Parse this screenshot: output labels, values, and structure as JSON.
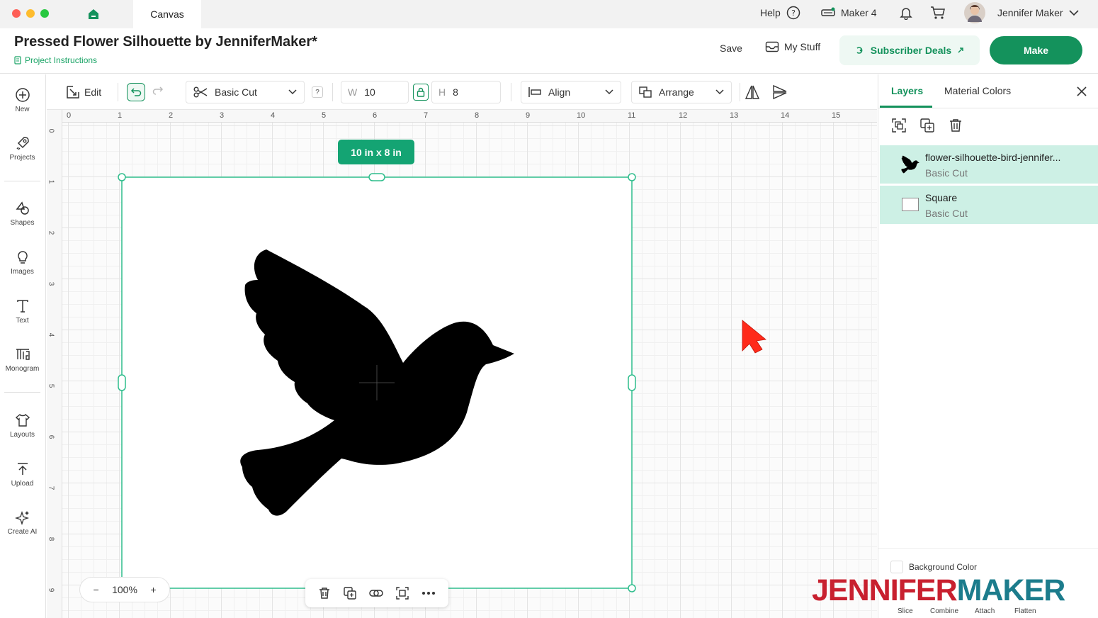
{
  "window": {
    "tab_title": "Canvas",
    "help_label": "Help",
    "machine_label": "Maker 4",
    "user_name": "Jennifer Maker"
  },
  "project": {
    "title": "Pressed Flower Silhouette by JenniferMaker*",
    "instructions_label": "Project Instructions",
    "save_label": "Save",
    "mystuff_label": "My Stuff",
    "deals_label": "Subscriber Deals",
    "make_label": "Make"
  },
  "sidebar": {
    "items": [
      {
        "label": "New",
        "icon": "plus-circle-icon"
      },
      {
        "label": "Projects",
        "icon": "rocket-icon"
      },
      {
        "label": "Shapes",
        "icon": "shapes-icon"
      },
      {
        "label": "Images",
        "icon": "lightbulb-icon"
      },
      {
        "label": "Text",
        "icon": "text-icon"
      },
      {
        "label": "Monogram",
        "icon": "monogram-icon"
      },
      {
        "label": "Layouts",
        "icon": "shirt-icon"
      },
      {
        "label": "Upload",
        "icon": "upload-icon"
      },
      {
        "label": "Create AI",
        "icon": "sparkle-icon"
      }
    ]
  },
  "toolbar": {
    "edit_label": "Edit",
    "operation_label": "Basic Cut",
    "help_q": "?",
    "width_label": "W",
    "width_value": "10",
    "height_label": "H",
    "height_value": "8",
    "align_label": "Align",
    "arrange_label": "Arrange"
  },
  "canvas": {
    "ruler_top": [
      "0",
      "1",
      "2",
      "3",
      "4",
      "5",
      "6",
      "7",
      "8",
      "9",
      "10",
      "11",
      "12",
      "13",
      "14",
      "15"
    ],
    "ruler_left": [
      "0",
      "1",
      "2",
      "3",
      "4",
      "5",
      "6",
      "7",
      "8",
      "9"
    ],
    "dimension_badge": "10  in x 8  in",
    "zoom_value": "100%",
    "zoom_minus": "−",
    "zoom_plus": "+",
    "accent_color": "#2ebd8c"
  },
  "panel": {
    "tab_layers": "Layers",
    "tab_material_colors": "Material Colors",
    "layers": [
      {
        "name": "flower-silhouette-bird-jennifer...",
        "operation": "Basic Cut"
      },
      {
        "name": "Square",
        "operation": "Basic Cut"
      }
    ],
    "background_color_label": "Background Color",
    "bottom_tools": [
      "Slice",
      "Combine",
      "Attach",
      "Flatten"
    ]
  },
  "watermark": {
    "part1": "JENNIFER",
    "part2": "MAKER"
  },
  "colors": {
    "brand_green": "#14925c",
    "layer_highlight": "#cdf0e5",
    "cursor": "#ff2a1a"
  }
}
